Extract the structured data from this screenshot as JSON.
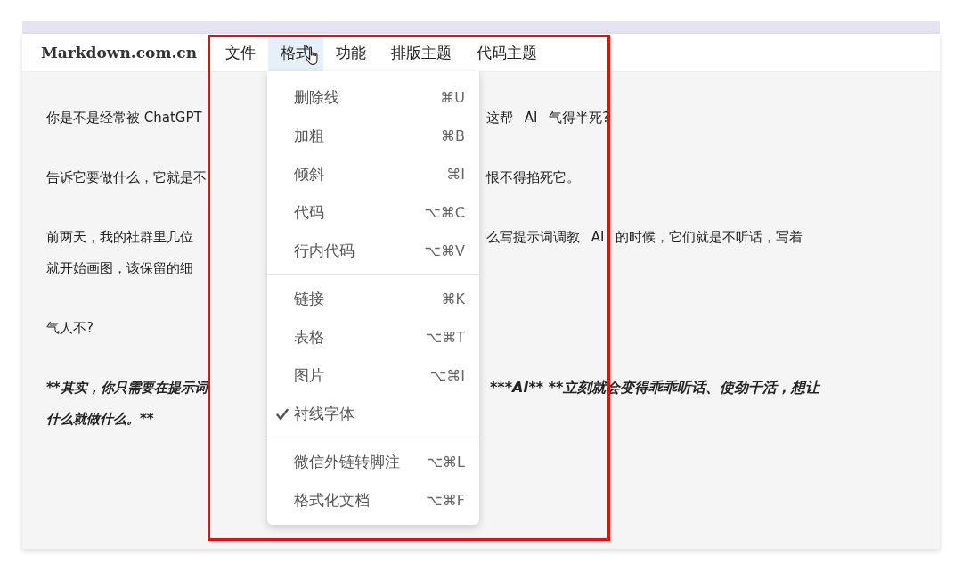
{
  "app": {
    "logo": "Markdown.com.cn"
  },
  "menubar": [
    {
      "label": "文件",
      "selected": false
    },
    {
      "label": "格式",
      "selected": true
    },
    {
      "label": "功能",
      "selected": false
    },
    {
      "label": "排版主题",
      "selected": false
    },
    {
      "label": "代码主题",
      "selected": false
    }
  ],
  "editor_lines": [
    {
      "kind": "normal",
      "left": "你是不是经常被 ChatGPT",
      "right": "这帮 AI 气得半死?"
    },
    {
      "kind": "blank"
    },
    {
      "kind": "normal",
      "left": "告诉它要做什么，它就是不",
      "right": "恨不得掐死它。"
    },
    {
      "kind": "blank"
    },
    {
      "kind": "normal",
      "left": "前两天，我的社群里几位",
      "right": "么写提示词调教 AI 的时候，它们就是不听话，写着"
    },
    {
      "kind": "normal",
      "left": "就开始画图，该保留的细"
    },
    {
      "kind": "blank"
    },
    {
      "kind": "normal",
      "left": "气人不?"
    },
    {
      "kind": "blank"
    },
    {
      "kind": "strong",
      "left": "**其实，你只需要在提示词",
      "right": "***AI** **立刻就会变得乖乖听话、使劲干活，想让"
    },
    {
      "kind": "strong",
      "left": "什么就做什么。**"
    }
  ],
  "format_menu": [
    {
      "kind": "item",
      "label": "删除线",
      "shortcut": "⌘U",
      "checked": false
    },
    {
      "kind": "item",
      "label": "加粗",
      "shortcut": "⌘B",
      "checked": false
    },
    {
      "kind": "item",
      "label": "倾斜",
      "shortcut": "⌘I",
      "checked": false
    },
    {
      "kind": "item",
      "label": "代码",
      "shortcut": "⌥⌘C",
      "checked": false
    },
    {
      "kind": "item",
      "label": "行内代码",
      "shortcut": "⌥⌘V",
      "checked": false
    },
    {
      "kind": "separator"
    },
    {
      "kind": "item",
      "label": "链接",
      "shortcut": "⌘K",
      "checked": false
    },
    {
      "kind": "item",
      "label": "表格",
      "shortcut": "⌥⌘T",
      "checked": false
    },
    {
      "kind": "item",
      "label": "图片",
      "shortcut": "⌥⌘I",
      "checked": false
    },
    {
      "kind": "item",
      "label": "衬线字体",
      "checked": true
    },
    {
      "kind": "separator"
    },
    {
      "kind": "item",
      "label": "微信外链转脚注",
      "shortcut": "⌥⌘L",
      "checked": false
    },
    {
      "kind": "item",
      "label": "格式化文档",
      "shortcut": "⌥⌘F",
      "checked": false
    }
  ]
}
